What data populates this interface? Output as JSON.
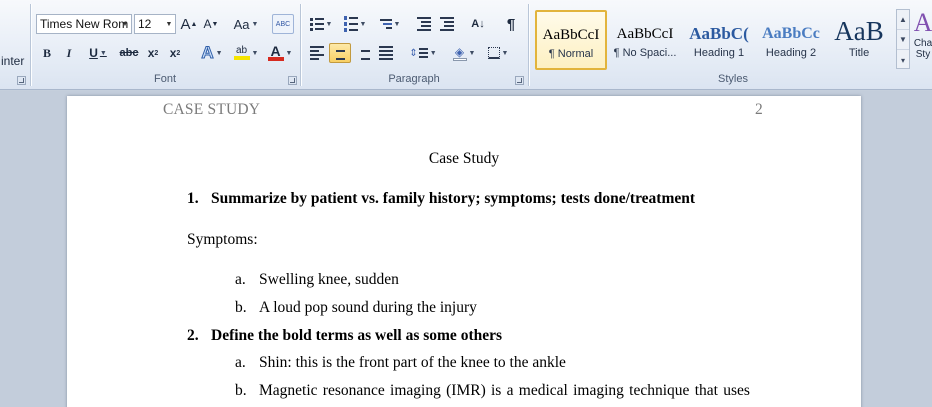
{
  "ribbon": {
    "clipboard_fragment": "inter",
    "font": {
      "group_label": "Font",
      "family_value": "Times New Rom",
      "size_value": "12",
      "grow_label": "A",
      "shrink_label": "A",
      "change_case_label": "Aa",
      "clear_format_label": "ABC",
      "bold_label": "B",
      "italic_label": "I",
      "underline_label": "U",
      "strike_label": "abc",
      "subscript_label": "x",
      "superscript_label": "x",
      "subscript_mark": "2",
      "superscript_mark": "2",
      "text_effects_label": "A",
      "highlight_label": "ab",
      "font_color_label": "A",
      "highlight_color": "#f5e400",
      "font_color": "#d62a1f"
    },
    "paragraph": {
      "group_label": "Paragraph",
      "sort_label": "A↓",
      "pilcrow_label": "¶"
    },
    "styles": {
      "group_label": "Styles",
      "items": [
        {
          "sample": "AaBbCcI",
          "name": "¶ Normal"
        },
        {
          "sample": "AaBbCcI",
          "name": "¶ No Spaci..."
        },
        {
          "sample": "AaBbC(",
          "name": "Heading 1"
        },
        {
          "sample": "AaBbCc",
          "name": "Heading 2"
        },
        {
          "sample": "AaB",
          "name": "Title"
        }
      ],
      "change_styles_sample": "A",
      "change_styles_line1": "Cha",
      "change_styles_line2": "Sty"
    },
    "accent_color": "#2c5aa0"
  },
  "document": {
    "header_left": "CASE STUDY",
    "header_right": "2",
    "title": "Case Study",
    "q1_number": "1.",
    "q1_text": "Summarize by patient vs. family history; symptoms; tests done/treatment",
    "symptoms_label": "Symptoms:",
    "symptoms": [
      {
        "marker": "a.",
        "text": "Swelling knee, sudden"
      },
      {
        "marker": "b.",
        "text": "A loud pop sound during the injury"
      }
    ],
    "q2_number": "2.",
    "q2_text": "Define the bold terms as well as some others",
    "definitions": [
      {
        "marker": "a.",
        "text": "Shin: this is the front part of the knee to the ankle"
      },
      {
        "marker": "b.",
        "text": "Magnetic resonance imaging (IMR) is a medical imaging technique that uses"
      }
    ]
  }
}
